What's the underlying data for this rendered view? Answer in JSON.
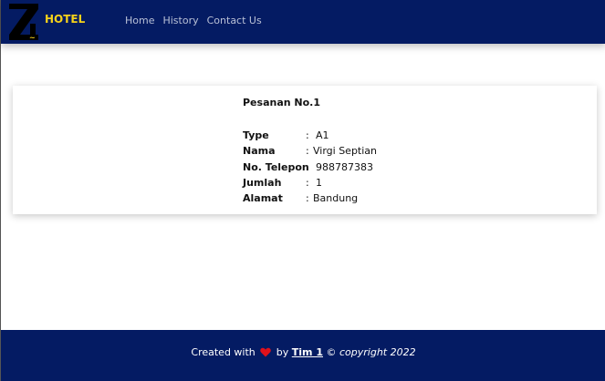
{
  "navbar": {
    "brand": "HOTEL",
    "links": [
      "Home",
      "History",
      "Contact Us"
    ],
    "colors": {
      "background": "#041b63",
      "brand": "#f6d21a"
    }
  },
  "order": {
    "title": "Pesanan No.1",
    "fields": [
      {
        "label": "Type",
        "colon": ":",
        "value": "A1"
      },
      {
        "label": "Nama",
        "colon": ":",
        "value": "Virgi Septian"
      },
      {
        "label": "No. Telepon",
        "colon": ":",
        "value": "988787383"
      },
      {
        "label": "Jumlah",
        "colon": ":",
        "value": "1"
      },
      {
        "label": "Alamat",
        "colon": ":",
        "value": "Bandung"
      }
    ]
  },
  "footer": {
    "prefix": "Created with",
    "icon": "heart-icon",
    "by": "by",
    "team": "Tim 1",
    "copyright": "© copyright 2022"
  }
}
